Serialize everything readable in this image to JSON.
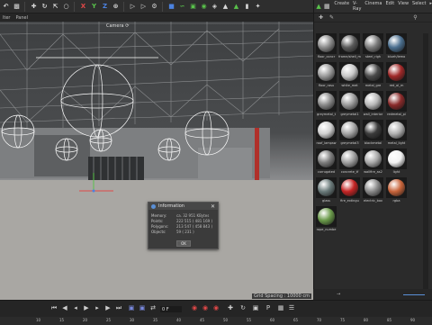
{
  "viewport": {
    "menu": [
      "lter",
      "Panel"
    ],
    "camera_label": "Camera ⟳",
    "grid_spacing": "Grid Spacing : 10000 cm"
  },
  "right_panel": {
    "menu": [
      "Create",
      "V-Ray",
      "Cinema",
      "Edit",
      "View",
      "Select",
      "▸"
    ],
    "materials": [
      {
        "name": "floor_concr",
        "color": "#8b8b8b"
      },
      {
        "name": "frame/shell_m",
        "color": "#5a5a5a"
      },
      {
        "name": "steel_righ",
        "color": "#7a7a7a"
      },
      {
        "name": "blueh/lemo",
        "color": "#4b6f8f"
      },
      {
        "name": "floor_rasu",
        "color": "#9a9a9a"
      },
      {
        "name": "white_met",
        "color": "#c8c8c8"
      },
      {
        "name": "metal_gre",
        "color": "#4a4a4a"
      },
      {
        "name": "red_ol_m",
        "color": "#a02828"
      },
      {
        "name": "greymetal_t",
        "color": "#888888"
      },
      {
        "name": "greymetal1",
        "color": "#9a9a9a"
      },
      {
        "name": "wall_interior",
        "color": "#b8b8b8"
      },
      {
        "name": "redmetal_pi",
        "color": "#8a2a2a"
      },
      {
        "name": "roof_lampsw",
        "color": "#d0d0d0"
      },
      {
        "name": "greymetal3",
        "color": "#a4a4a4"
      },
      {
        "name": "blackmetal",
        "color": "#3a3a3a"
      },
      {
        "name": "metal_light",
        "color": "#b0b0b0"
      },
      {
        "name": "corrugated",
        "color": "#7c7c7c"
      },
      {
        "name": "concrete_tf",
        "color": "#9e9e9e"
      },
      {
        "name": "wallfire_as2",
        "color": "#a8a8a8"
      },
      {
        "name": "light",
        "color": "#f2f2f2"
      },
      {
        "name": "glass",
        "color": "#6a7a7a"
      },
      {
        "name": "fire_extingu",
        "color": "#c42424"
      },
      {
        "name": "electric_box",
        "color": "#8a8a8a"
      },
      {
        "name": "rgba",
        "color": "#c8643a"
      },
      {
        "name": "rope_numbe",
        "color": "#6a9a4a"
      }
    ],
    "link_text": "→",
    "accent": "#5a8fd6"
  },
  "dialog": {
    "title": "Information",
    "rows": [
      {
        "label": "Memory:",
        "value": "ca. 32 951 KBytes"
      },
      {
        "label": "Points:",
        "value": "222 515 ( 481 169 )"
      },
      {
        "label": "Polygons:",
        "value": "213 547 ( 458 843 )"
      },
      {
        "label": "Objects:",
        "value": "59 ( 231 )"
      }
    ],
    "ok_label": "OK"
  },
  "timeline": {
    "frame": "0 F",
    "ticks": [
      "10",
      "15",
      "20",
      "25",
      "30",
      "35",
      "40",
      "45",
      "50",
      "55",
      "60",
      "65",
      "70",
      "75",
      "80",
      "85",
      "90"
    ]
  }
}
